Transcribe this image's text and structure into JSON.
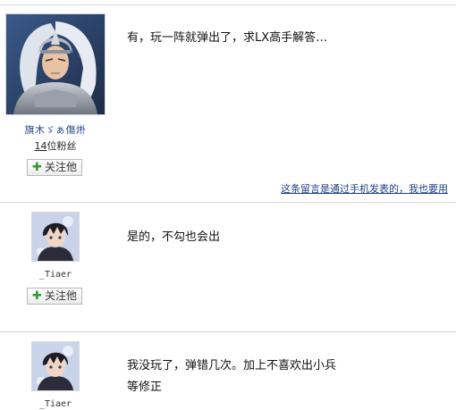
{
  "comments": [
    {
      "username": "旗木ゞぁ傷烞",
      "fans_count": "14",
      "fans_suffix": "位粉丝",
      "follow_label": "关注他",
      "message": "有，玩一阵就弹出了，求LX高手解答…",
      "avatar_icon": "warrior-avatar-icon"
    },
    {
      "username": "_Tiaer",
      "follow_label": "关注他",
      "message": "是的，不勾也会出",
      "avatar_icon": "anime-boy-avatar-icon"
    },
    {
      "username": "_Tiaer",
      "message_line1": "我没玩了，弹错几次。加上不喜欢出小兵",
      "message_line2": "等修正",
      "avatar_icon": "anime-boy-avatar-icon"
    }
  ],
  "mobile_note": "这条留言是通过手机发表的，我也要用",
  "colors": {
    "link": "#1f3f86",
    "username": "#2b4a8a",
    "plus": "#2e9a2e",
    "divider": "#d6d6d6"
  }
}
